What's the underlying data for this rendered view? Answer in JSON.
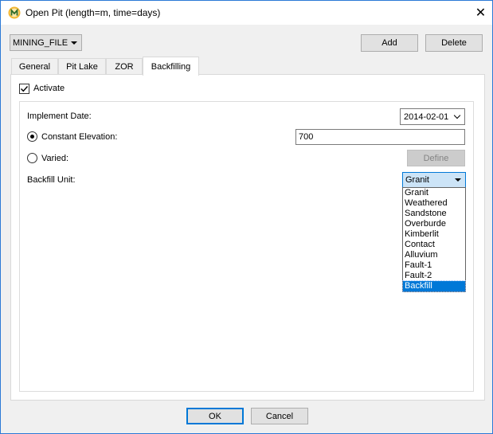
{
  "window": {
    "title": "Open Pit (length=m, time=days)",
    "close_glyph": "✕",
    "icon": "mining-app-icon"
  },
  "file_selector": {
    "value": "MINING_FILE"
  },
  "toolbar": {
    "add_label": "Add",
    "delete_label": "Delete"
  },
  "tabs": [
    {
      "label": "General"
    },
    {
      "label": "Pit Lake"
    },
    {
      "label": "ZOR"
    },
    {
      "label": "Backfilling",
      "active": true
    }
  ],
  "backfilling": {
    "activate_label": "Activate",
    "activate_checked": true,
    "implement_date_label": "Implement Date:",
    "implement_date_value": "2014-02-01",
    "constant_elevation_label": "Constant Elevation:",
    "constant_elevation_value": "700",
    "constant_elevation_selected": true,
    "varied_label": "Varied:",
    "define_label": "Define",
    "backfill_unit_label": "Backfill Unit:",
    "backfill_unit_value": "Granit",
    "backfill_unit_options": [
      "Granit",
      "Weathered",
      "Sandstone",
      "Overburde",
      "Kimberlit",
      "Contact",
      "Alluvium",
      "Fault-1",
      "Fault-2",
      "Backfill"
    ],
    "highlighted_option": "Backfill"
  },
  "footer": {
    "ok_label": "OK",
    "cancel_label": "Cancel"
  },
  "colors": {
    "accent": "#0078d7",
    "combo_open_bg": "#cce4f7"
  }
}
